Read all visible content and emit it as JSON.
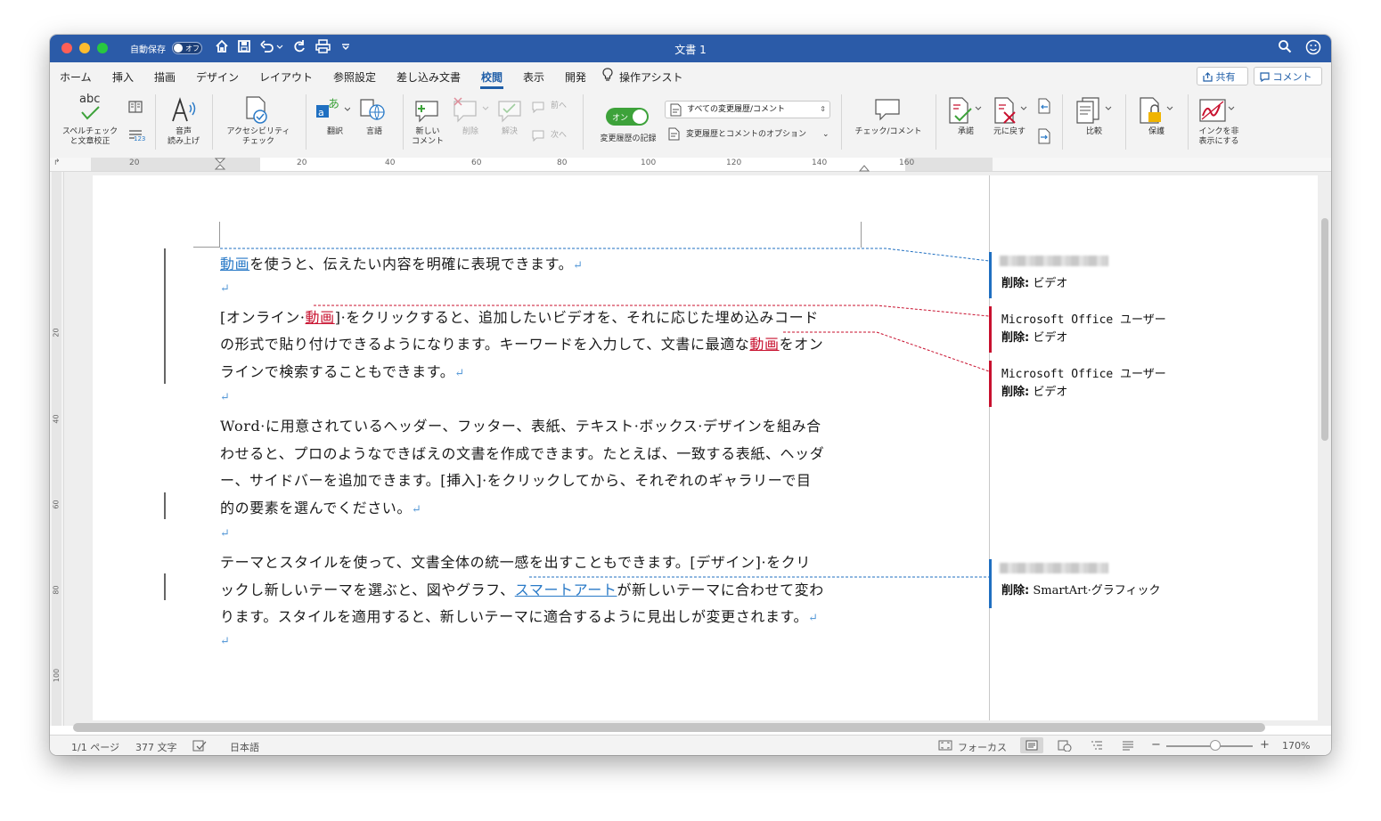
{
  "titlebar": {
    "autosave_label": "自動保存",
    "autosave_state": "オフ",
    "title": "文書 1",
    "icons": [
      "home-icon",
      "save-icon",
      "undo-icon",
      "redo-icon",
      "print-icon",
      "customize-icon",
      "search-icon",
      "smiley-icon"
    ]
  },
  "tabs": {
    "items": [
      "ホーム",
      "挿入",
      "描画",
      "デザイン",
      "レイアウト",
      "参照設定",
      "差し込み文書",
      "校閲",
      "表示",
      "開発",
      "操作アシスト"
    ],
    "active": "校閲",
    "share_label": "共有",
    "comment_label": "コメント"
  },
  "ribbon": {
    "spelling_label_1": "スペルチェック",
    "spelling_label_2": "と文章校正",
    "read_aloud_1": "音声",
    "read_aloud_2": "読み上げ",
    "accessibility_1": "アクセシビリティ",
    "accessibility_2": "チェック",
    "translate": "翻訳",
    "language": "言語",
    "new_comment_1": "新しい",
    "new_comment_2": "コメント",
    "delete": "削除",
    "resolve": "解決",
    "previous": "前へ",
    "next": "次へ",
    "track_toggle": "オン",
    "track_changes": "変更履歴の記録",
    "markup_select": "すべての変更履歴/コメント",
    "markup_options": "変更履歴とコメントのオプション",
    "check_comment": "チェック/コメント",
    "accept": "承諾",
    "reject": "元に戻す",
    "compare": "比較",
    "protect": "保護",
    "hide_ink_1": "インクを非",
    "hide_ink_2": "表示にする",
    "abc_label": "abc",
    "count_label": "123"
  },
  "ruler": {
    "numbers": [
      "20",
      "2",
      "20",
      "40",
      "60",
      "80",
      "100",
      "120",
      "140",
      "160"
    ],
    "vnumbers": [
      "20",
      "40",
      "60",
      "80",
      "100"
    ]
  },
  "document": {
    "p1": {
      "ins": "動画",
      "rest": "を使うと、伝えたい内容を明確に表現できます。"
    },
    "p2_line1": {
      "a": "[オンライン·",
      "del": "動画",
      "b": "]·をクリックすると、追加したいビデオを、それに応じた埋め込みコード"
    },
    "p2_line2": {
      "a": "の形式で貼り付けできるようになります。キーワードを入力して、文書に最適な",
      "del": "動画",
      "b": "をオン"
    },
    "p2_line3": "ラインで検索することもできます。",
    "p3_line1": "Word·に用意されているヘッダー、フッター、表紙、テキスト·ボックス·デザインを組み合",
    "p3_line2": "わせると、プロのようなできばえの文書を作成できます。たとえば、一致する表紙、ヘッダ",
    "p3_line3": "ー、サイドバーを追加できます。[挿入]·をクリックしてから、それぞれのギャラリーで目",
    "p3_line4": "的の要素を選んでください。",
    "p4_line1": "テーマとスタイルを使って、文書全体の統一感を出すこともできます。[デザイン]·をクリ",
    "p4_line2": {
      "a": "ックし新しいテーマを選ぶと、図やグラフ、",
      "ins": "スマートアート",
      "b": "が新しいテーマに合わせて変わ"
    },
    "p4_line3": "ります。スタイルを適用すると、新しいテーマに適合するように見出しが変更されます。",
    "para_mark": "↵"
  },
  "balloons": [
    {
      "author": "",
      "label": "削除:",
      "text": "ビデオ",
      "color": "#1f6fc1"
    },
    {
      "author": "Microsoft Office ユーザー",
      "label": "削除:",
      "text": "ビデオ",
      "color": "#c8102e"
    },
    {
      "author": "Microsoft Office ユーザー",
      "label": "削除:",
      "text": "ビデオ",
      "color": "#c8102e"
    },
    {
      "author": "",
      "label": "削除:",
      "text": "SmartArt·グラフィック",
      "color": "#1f6fc1"
    }
  ],
  "statusbar": {
    "page": "1/1 ページ",
    "words": "377 文字",
    "language": "日本語",
    "focus": "フォーカス",
    "zoom": "170%",
    "zoom_level": 0.5
  },
  "colors": {
    "titlebar": "#2b5ba8",
    "accent": "#1f5ea8",
    "insert": "#2a7ac7",
    "delete": "#c8102e",
    "track_on": "#3da23a"
  }
}
